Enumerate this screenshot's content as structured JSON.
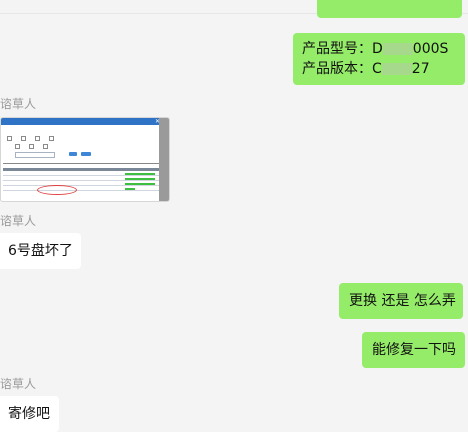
{
  "messages": [
    {
      "type": "outgoing_partial"
    },
    {
      "type": "outgoing",
      "lines": [
        "产品型号：D",
        "产品版本：C"
      ],
      "line_suffix": [
        "000S",
        "27"
      ]
    },
    {
      "type": "sender",
      "name": "谘草人"
    },
    {
      "type": "image"
    },
    {
      "type": "sender",
      "name": "谘草人"
    },
    {
      "type": "incoming",
      "text": "6号盘坏了"
    },
    {
      "type": "outgoing",
      "text": "更换 还是 怎么弄"
    },
    {
      "type": "outgoing",
      "text": "能修复一下吗"
    },
    {
      "type": "sender",
      "name": "谘草人"
    },
    {
      "type": "incoming",
      "text": "寄修吧"
    }
  ],
  "chat": {
    "product_model_prefix": "产品型号：D",
    "product_model_suffix": "000S",
    "product_version_prefix": "产品版本：C",
    "product_version_suffix": "27",
    "sender_name": "谘草人",
    "msg_disk": "6号盘坏了",
    "msg_replace": "更换 还是 怎么弄",
    "msg_repair": "能修复一下吗",
    "msg_send_repair": "寄修吧"
  },
  "colors": {
    "outgoing_bubble": "#95ec69",
    "incoming_bubble": "#ffffff",
    "background": "#f4f4f4",
    "sender_text": "#9a9a9a"
  }
}
